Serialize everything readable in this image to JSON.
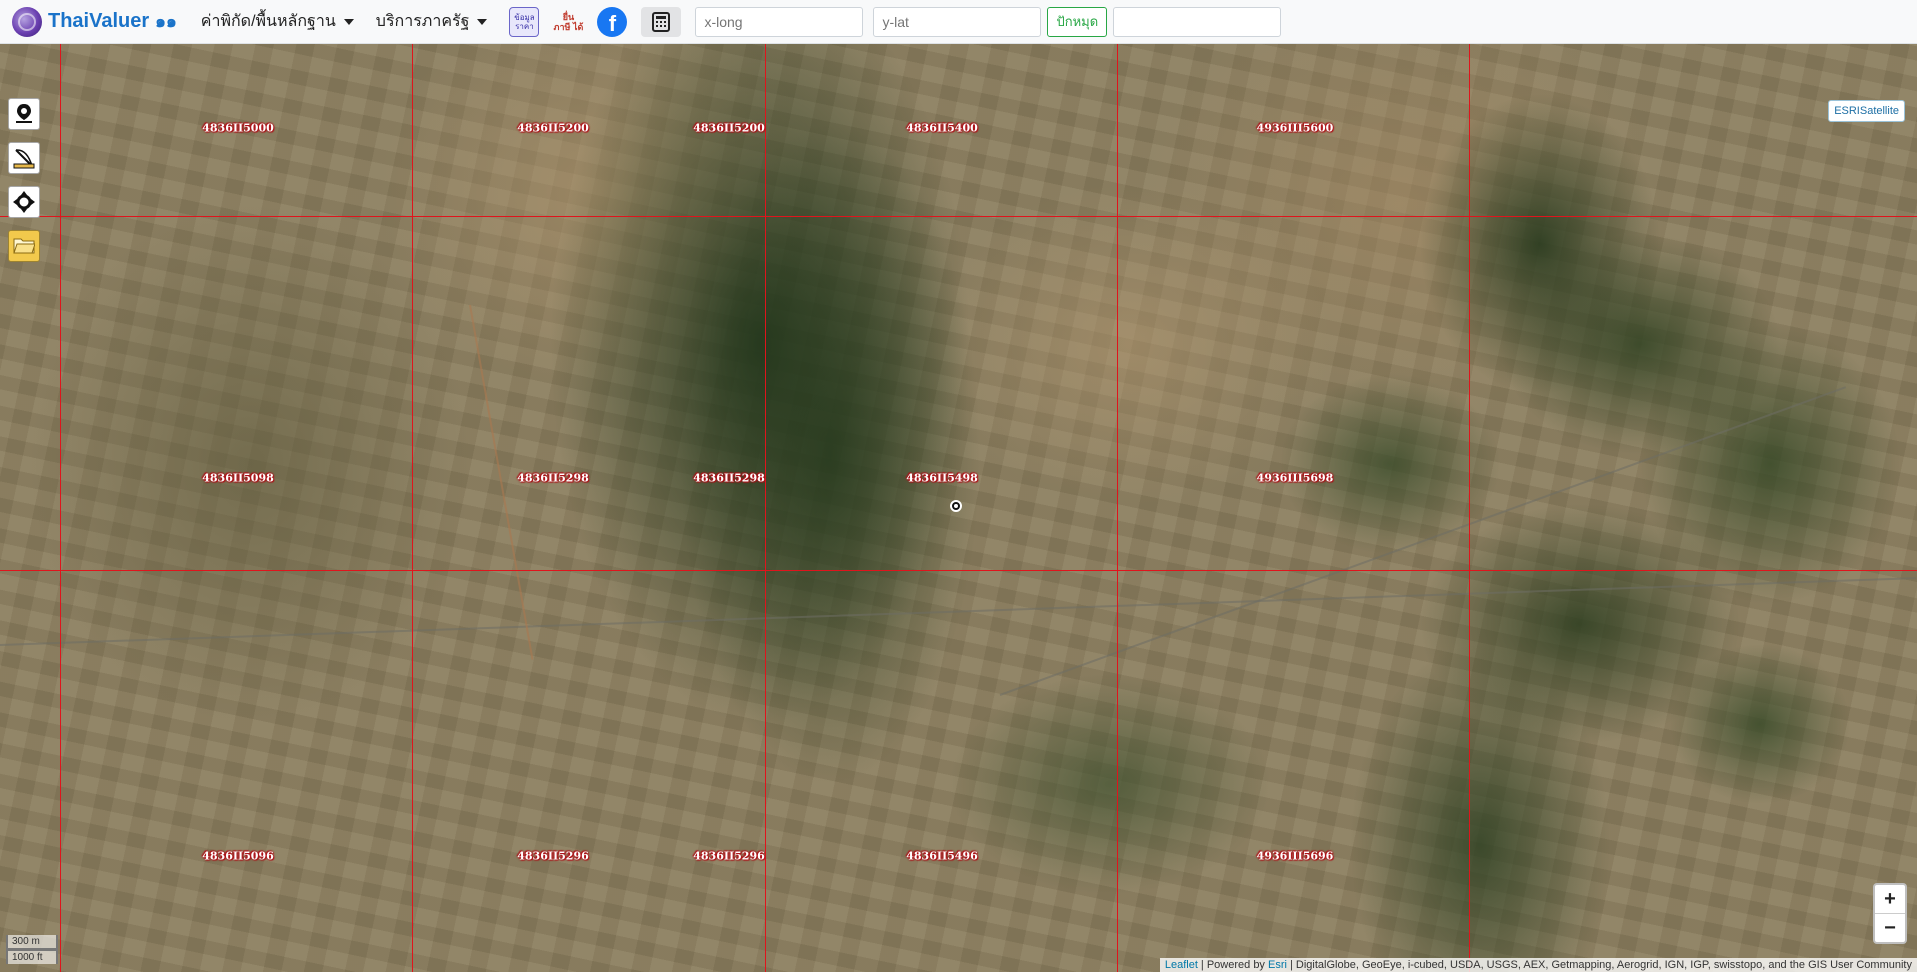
{
  "navbar": {
    "brand_name": "ThaiValuer",
    "brand_suffix": "๑๑",
    "menu": [
      {
        "label": "ค่าพิกัด/พื้นหลักฐาน"
      },
      {
        "label": "บริการภาครัฐ"
      }
    ],
    "survey_icon_text": "ข้อมูล ราคา",
    "tax_icon_text": "ยื่น ภาษี ได้",
    "facebook_icon_text": "f",
    "x_placeholder": "x-long",
    "y_placeholder": "y-lat",
    "pin_button": "ปักหมุด",
    "result_value": ""
  },
  "map": {
    "layer_switch_label": "ESRISatellite",
    "sheet_labels": [
      {
        "text": "4836II5000",
        "col": 0,
        "row": 0
      },
      {
        "text": "4836II5200",
        "col": 1,
        "row": 0
      },
      {
        "text": "4836II5200",
        "col": 2,
        "row": 0
      },
      {
        "text": "4836II5400",
        "col": 3,
        "row": 0
      },
      {
        "text": "4936III5600",
        "col": 4,
        "row": 0
      },
      {
        "text": "4836II5098",
        "col": 0,
        "row": 1
      },
      {
        "text": "4836II5298",
        "col": 1,
        "row": 1
      },
      {
        "text": "4836II5298",
        "col": 2,
        "row": 1
      },
      {
        "text": "4836II5498",
        "col": 3,
        "row": 1
      },
      {
        "text": "4936III5698",
        "col": 4,
        "row": 1
      },
      {
        "text": "4836II5096",
        "col": 0,
        "row": 2
      },
      {
        "text": "4836II5296",
        "col": 1,
        "row": 2
      },
      {
        "text": "4836II5296",
        "col": 2,
        "row": 2
      },
      {
        "text": "4836II5496",
        "col": 3,
        "row": 2
      },
      {
        "text": "4936III5696",
        "col": 4,
        "row": 2
      }
    ],
    "zoom_in": "+",
    "zoom_out": "−",
    "scale_metric": "300 m",
    "scale_imperial": "1000 ft",
    "attribution_leaflet": "Leaflet",
    "attribution_sep1": " | Powered by ",
    "attribution_esri": "Esri",
    "attribution_rest": " | DigitalGlobe, GeoEye, i-cubed, USDA, USGS, AEX, Getmapping, Aerogrid, IGN, IGP, swisstopo, and the GIS User Community"
  },
  "toolbar": [
    {
      "name": "location-pin-tool",
      "icon": "map-pin-icon"
    },
    {
      "name": "measure-tool",
      "icon": "ruler-icon"
    },
    {
      "name": "locate-tool",
      "icon": "crosshair-icon"
    },
    {
      "name": "open-file-tool",
      "icon": "folder-icon"
    }
  ]
}
